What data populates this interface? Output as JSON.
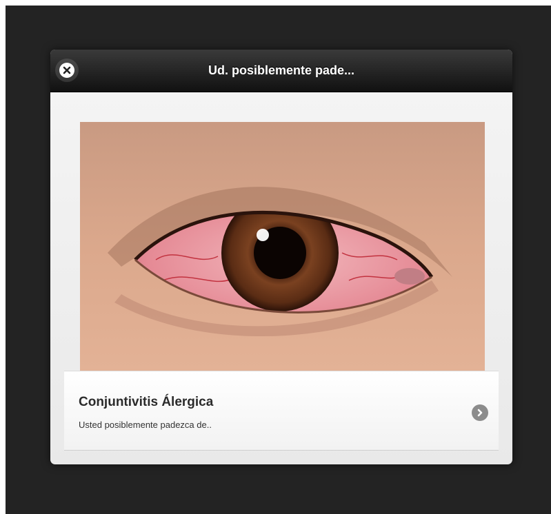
{
  "dialog": {
    "title": "Ud. posiblemente pade...",
    "close_icon": "close-icon"
  },
  "result": {
    "image_icon": "eye-illustration",
    "title": "Conjuntivitis Álergica",
    "description": "Usted posiblemente padezca de..",
    "arrow_icon": "chevron-right-icon"
  },
  "colors": {
    "backdrop": "#232323",
    "header": "#1e1e1e",
    "panel": "#f0f0f0"
  }
}
